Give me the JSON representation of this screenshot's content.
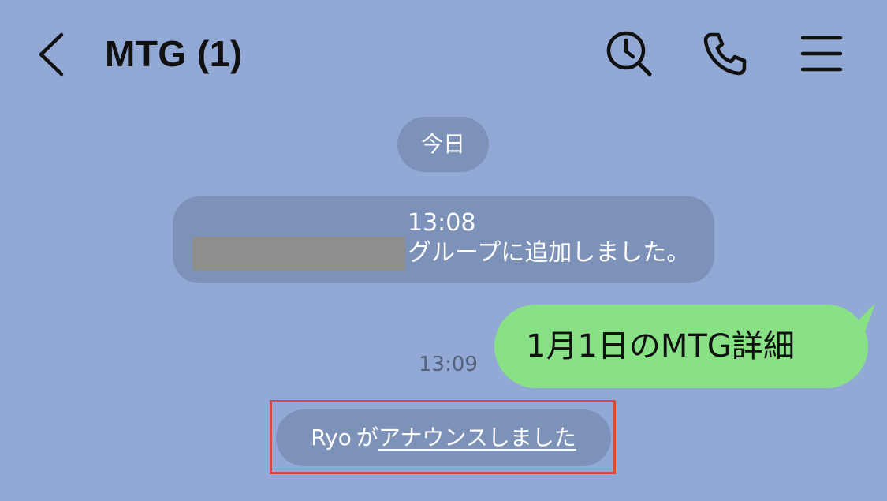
{
  "header": {
    "title": "MTG (1)",
    "icons": {
      "back": "chevron-left-icon",
      "search": "search-history-icon",
      "call": "phone-icon",
      "menu": "menu-icon"
    }
  },
  "chat": {
    "date_separator": "今日",
    "system_notice": {
      "time": "13:08",
      "text": "グループに追加しました。"
    },
    "outgoing_message": {
      "time": "13:09",
      "text": "1月1日のMTG詳細"
    },
    "announcement": {
      "user": "Ryo",
      "particle": "が",
      "link_text": "アナウンスしました"
    }
  },
  "colors": {
    "background": "#91a9d4",
    "pill": "#7c92b9",
    "outgoing_bubble": "#89e186",
    "highlight_border": "#d94a3a",
    "redaction": "#8e8e8e"
  }
}
